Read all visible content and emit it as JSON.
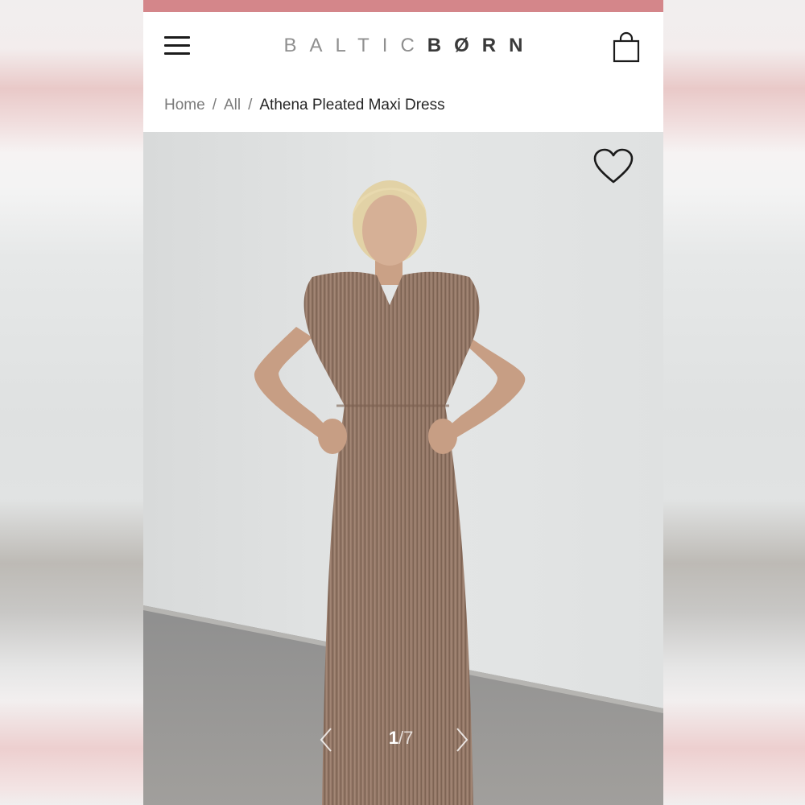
{
  "brand": {
    "logo_part1": "BALTIC",
    "logo_part2": "BØRN",
    "accent_color": "#d4868a"
  },
  "header": {
    "menu_icon": "hamburger-menu-icon",
    "cart_icon": "shopping-bag-icon"
  },
  "breadcrumb": {
    "items": [
      "Home",
      "All"
    ],
    "current": "Athena Pleated Maxi Dress",
    "separator": "/"
  },
  "gallery": {
    "current": "1",
    "separator": "/",
    "total": "7",
    "favorite_icon": "heart-outline-icon",
    "prev_icon": "chevron-left-icon",
    "next_icon": "chevron-right-icon"
  }
}
